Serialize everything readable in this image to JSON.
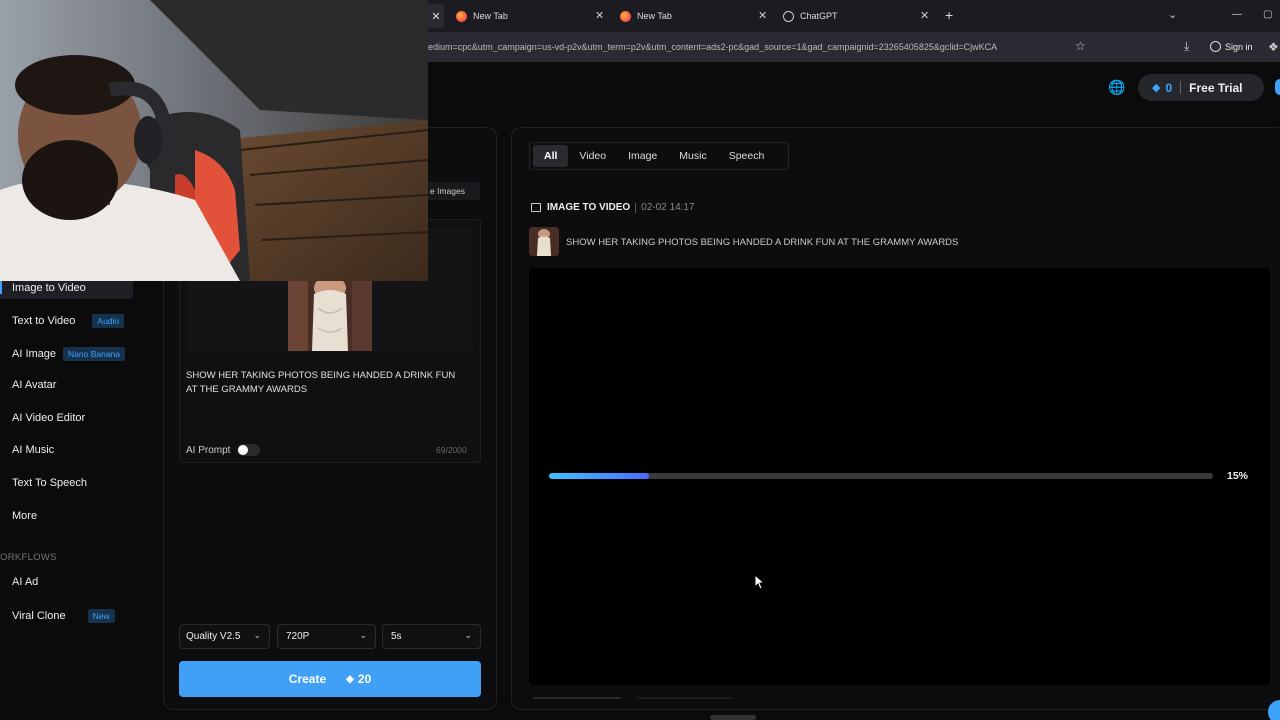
{
  "browser": {
    "tabs": [
      {
        "label": "New Tab",
        "icon": "firefox-icon"
      },
      {
        "label": "New Tab",
        "icon": "firefox-icon"
      },
      {
        "label": "ChatGPT",
        "icon": "chatgpt-icon"
      }
    ],
    "close_glyph": "✕",
    "new_tab_glyph": "+",
    "url": "edium=cpc&utm_campaign=us-vd-p2v&utm_term=p2v&utm_content=ads2-pc&gad_source=1&gad_campaignid=23265405825&gclid=CjwKCA",
    "sign_in": "Sign in"
  },
  "header": {
    "credits": "0",
    "free_trial": "Free Trial"
  },
  "sidebar": {
    "items": [
      {
        "label": "Image to Video",
        "badge": ""
      },
      {
        "label": "Text to Video",
        "badge": "Audio"
      },
      {
        "label": "AI Image",
        "badge": "Nano Banana"
      },
      {
        "label": "AI Avatar",
        "badge": ""
      },
      {
        "label": "AI Video Editor",
        "badge": ""
      },
      {
        "label": "AI Music",
        "badge": ""
      },
      {
        "label": "Text To Speech",
        "badge": ""
      },
      {
        "label": "More",
        "badge": ""
      }
    ],
    "section_label": "ORKFLOWS",
    "workflow_items": [
      {
        "label": "AI Ad",
        "badge": ""
      },
      {
        "label": "Viral Clone",
        "badge": "New"
      }
    ]
  },
  "editor": {
    "uploaded_link": "e Images",
    "prompt": "SHOW HER TAKING PHOTOS BEING HANDED A DRINK FUN AT THE GRAMMY AWARDS",
    "ai_prompt_label": "AI Prompt",
    "char_count": "69/2000",
    "quality": "Quality V2.5",
    "resolution": "720P",
    "duration": "5s",
    "create_label": "Create",
    "create_cost": "20"
  },
  "results": {
    "filters": [
      "All",
      "Video",
      "Image",
      "Music",
      "Speech"
    ],
    "active_filter": "All",
    "job": {
      "type": "IMAGE TO VIDEO",
      "timestamp": "02-02 14:17",
      "prompt": "SHOW HER TAKING PHOTOS BEING HANDED A DRINK FUN AT THE GRAMMY AWARDS",
      "progress_percent": 15,
      "progress_label": "15%"
    }
  }
}
